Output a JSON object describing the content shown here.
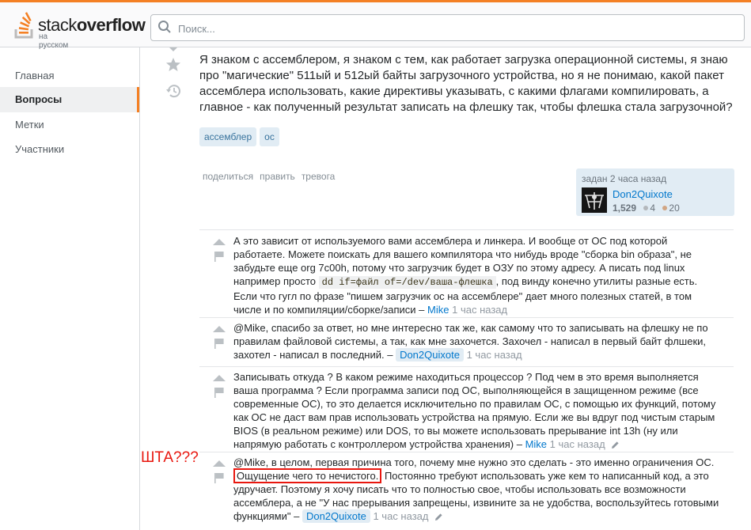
{
  "header": {
    "logo_stack": "stack",
    "logo_overflow": "overflow",
    "logo_subtitle": "на русском",
    "search_placeholder": "Поиск..."
  },
  "sidebar": {
    "items": [
      {
        "label": "Главная"
      },
      {
        "label": "Вопросы",
        "active": true
      },
      {
        "label": "Метки"
      },
      {
        "label": "Участники"
      }
    ]
  },
  "question": {
    "body": "Я знаком с ассемблером, я знаком с тем, как работает загрузка операционной системы, я знаю про \"магические\" 511ый и 512ый байты загрузочного устройства, но я не понимаю, какой пакет ассемблера использовать, какие директивы указывать, с какими флагами компилировать, а главное - как полученный результат записать на флешку так, чтобы флешка стала загрузочной?",
    "tags": [
      "ассемблер",
      "ос"
    ],
    "menu": [
      "поделиться",
      "править",
      "тревога"
    ],
    "asked": "задан 2 часа назад",
    "owner": {
      "name": "Don2Quixote",
      "reputation": "1,529",
      "silver": "4",
      "bronze": "20"
    }
  },
  "comments": [
    {
      "text_before_code": "А это зависит от используемого вами ассемблера и линкера. И вообще от ОС под которой работаете. Можете поискать для вашего компилятора что нибудь вроде \"сборка bin образа\", не забудьте еще org 7c00h, потому что загрузчик будет в ОЗУ по этому адресу. А писать под linux например просто",
      "code": "dd if=файл of=/dev/ваша-флешка",
      "text_after_code": ", под винду конечно утилиты разные есть. Если что гугл по фразе \"пишем загрузчик ос на ассемблере\" дает много полезных статей, в том числе и по компиляции/сборке/записи –",
      "user": "Mike",
      "time": "1 час назад"
    },
    {
      "text": "@Mike, спасибо за ответ, но мне интересно так же, как самому что то записывать на флешку не по правилам файловой системы, а так, как мне захочется. Захочел - написал в первый байт флшеки, захотел - написал в последний. –",
      "user": "Don2Quixote",
      "time": "1 час назад"
    },
    {
      "text": "Записывать откуда ? В каком режиме находиться процессор ? Под чем в это время выполняется ваша программа ? Если программа записи под ОС, выполняющейся в защищенном режиме (все современные ОС), то это делается исключительно по правилам ОС, с помощью их функций, потому как ОС не даст вам прав использовать устройства на прямую. Если же вы вдруг под чистым старым BIOS (в реальном режиме) или DOS, то вы можете использовать прерывание int 13h (ну или напрямую работать с контроллером устройства хранения) –",
      "user": "Mike",
      "time": "1 час назад"
    },
    {
      "text_before": "@Mike, в целом, первая причина того, почему мне нужно это сделать - это именно ограничения ОС.",
      "highlighted": "Ощущение чего то нечистого.",
      "text_after": "Постоянно требуют использовать уже кем то написанный код, а это удручает. Поэтому я хочу писать что то полностью свое, чтобы использовать все возможности ассемблера, а не \"У нас прерывания запрещены, извините за не удобства, воспользуйтесь готовыми функциями\" –",
      "user": "Don2Quixote",
      "time": "1 час назад"
    }
  ],
  "annotation": "ШТА???",
  "colors": {
    "accent": "#f48024",
    "link": "#0077cc",
    "tag_bg": "#e1ecf4",
    "annotation_red": "#e8170f"
  }
}
